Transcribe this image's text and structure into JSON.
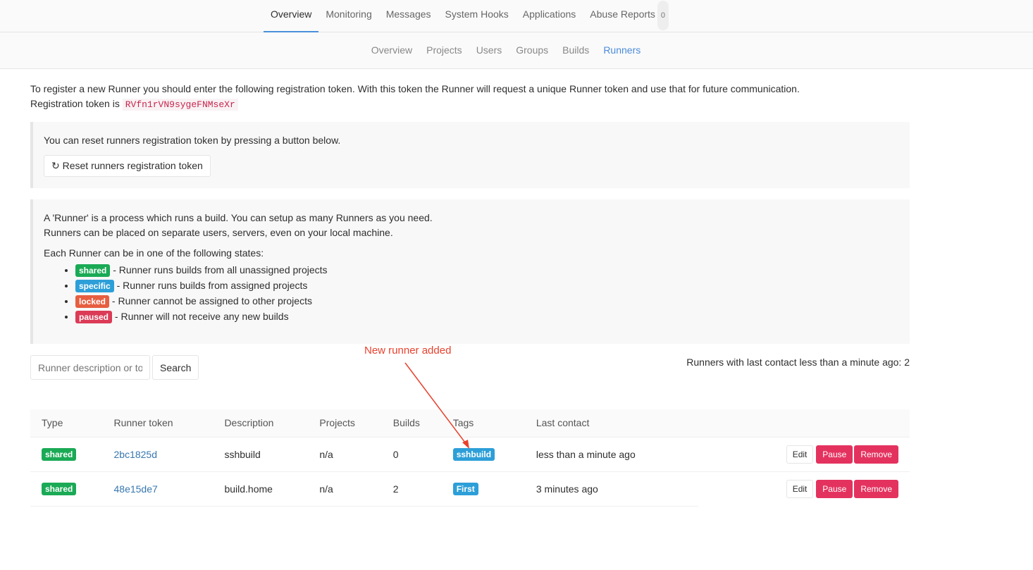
{
  "top_nav": {
    "items": [
      "Overview",
      "Monitoring",
      "Messages",
      "System Hooks",
      "Applications",
      "Abuse Reports"
    ],
    "active": "Overview",
    "abuse_count": "0"
  },
  "sub_nav": {
    "items": [
      "Overview",
      "Projects",
      "Users",
      "Groups",
      "Builds",
      "Runners"
    ],
    "active": "Runners"
  },
  "intro": {
    "line1": "To register a new Runner you should enter the following registration token. With this token the Runner will request a unique Runner token and use that for future communication.",
    "line2_prefix": "Registration token is",
    "token": "RVfn1rVN9sygeFNMseXr"
  },
  "reset": {
    "text": "You can reset runners registration token by pressing a button below.",
    "button": "Reset runners registration token",
    "icon": "refresh-icon"
  },
  "info": {
    "line1": "A 'Runner' is a process which runs a build. You can setup as many Runners as you need.",
    "line2": "Runners can be placed on separate users, servers, even on your local machine.",
    "states_heading": "Each Runner can be in one of the following states:",
    "states": [
      {
        "label": "shared",
        "color": "#1aaa55",
        "text": "- Runner runs builds from all unassigned projects"
      },
      {
        "label": "specific",
        "color": "#2d9fd8",
        "text": "- Runner runs builds from assigned projects"
      },
      {
        "label": "locked",
        "color": "#e75e40",
        "text": "- Runner cannot be assigned to other projects"
      },
      {
        "label": "paused",
        "color": "#db3b57",
        "text": "- Runner will not receive any new builds"
      }
    ]
  },
  "search": {
    "placeholder": "Runner description or token",
    "button": "Search"
  },
  "runner_count": "Runners with last contact less than a minute ago: 2",
  "annotation": "New runner added",
  "table": {
    "headers": [
      "Type",
      "Runner token",
      "Description",
      "Projects",
      "Builds",
      "Tags",
      "Last contact"
    ],
    "rows": [
      {
        "type": "shared",
        "token": "2bc1825d",
        "description": "sshbuild",
        "projects": "n/a",
        "builds": "0",
        "tag": "sshbuild",
        "last_contact": "less than a minute ago",
        "edit": "Edit",
        "pause": "Pause",
        "remove": "Remove"
      },
      {
        "type": "shared",
        "token": "48e15de7",
        "description": "build.home",
        "projects": "n/a",
        "builds": "2",
        "tag": "First",
        "last_contact": "3 minutes ago",
        "edit": "Edit",
        "pause": "Pause",
        "remove": "Remove"
      }
    ]
  }
}
